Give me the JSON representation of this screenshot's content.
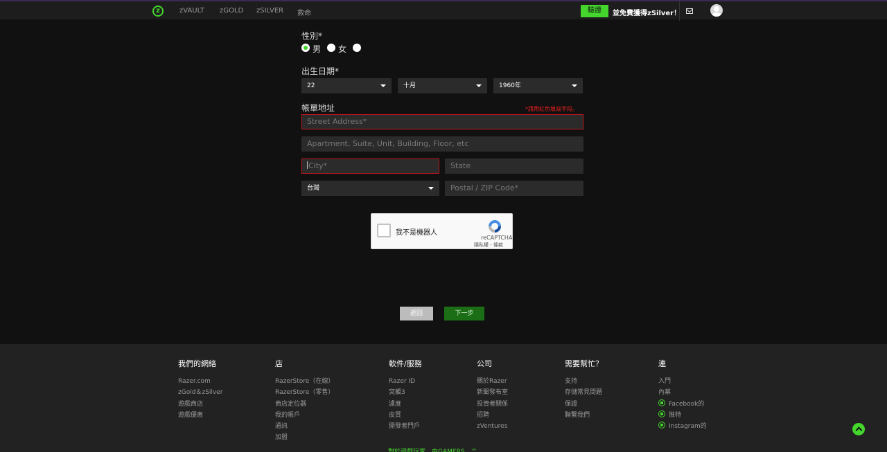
{
  "nav": {
    "logo_letter": "z",
    "links": [
      "zVAULT",
      "zGOLD",
      "zSILVER",
      "救命"
    ],
    "verify_label": "驗證",
    "promo_text": "並免費獲得zSilver！"
  },
  "form": {
    "gender": {
      "label": "性別*",
      "options": [
        "男",
        "女",
        ""
      ],
      "selected": "男"
    },
    "dob": {
      "label": "出生日期*",
      "day": "22",
      "month": "十月",
      "year": "1960年"
    },
    "billing": {
      "label": "帳單地址",
      "required_note": "*請用紅色填寫字段。",
      "street_placeholder": "Street Address*",
      "apt_placeholder": "Apartment, Suite, Unit, Building, Floor, etc",
      "city_placeholder": "City*",
      "state_placeholder": "State",
      "country": "台灣",
      "zip_placeholder": "Postal / ZIP Code*"
    }
  },
  "captcha": {
    "checkbox_label": "我不是機器人",
    "brand": "reCAPTCHA",
    "terms": "隱私權 - 條款"
  },
  "buttons": {
    "back": "返回",
    "next": "下一步"
  },
  "footer": {
    "columns": [
      {
        "heading": "我們的網絡",
        "links": [
          "Razer.com",
          "zGold＆zSilver",
          "遊戲商店",
          "遊戲優惠"
        ]
      },
      {
        "heading": "店",
        "links": [
          "RazerStore（在線）",
          "RazerStore（零售）",
          "商店定位器",
          "我的帳戶",
          "通訊",
          "加盟"
        ]
      },
      {
        "heading": "軟件/服務",
        "links": [
          "Razer ID",
          "突觸3",
          "濾度",
          "皮質",
          "開發者門戶"
        ]
      },
      {
        "heading": "公司",
        "links": [
          "關於Razer",
          "新聞發布室",
          "投資者關係",
          "招聘",
          "zVentures"
        ]
      },
      {
        "heading": "需要幫忙？",
        "links": [
          "支持",
          "存儲常見問題",
          "保證",
          "聯繫我們"
        ]
      },
      {
        "heading": "連",
        "links": [
          "入門",
          "內幕",
          "Facebook的",
          "推特",
          "Instagram的"
        ]
      }
    ],
    "tagline": "對於遊戲玩家。由GAMERS。™"
  }
}
